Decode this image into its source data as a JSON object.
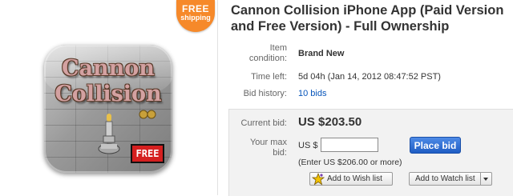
{
  "badge": {
    "line1": "FREE",
    "line2": "shipping"
  },
  "app_icon": {
    "word1": "Cannon",
    "word2": "Collision",
    "tag": "FREE"
  },
  "listing": {
    "title": "Cannon Collision iPhone App (Paid Version and Free Version) - Full Ownership",
    "condition_label": "Item condition:",
    "condition_value": "Brand New",
    "time_left_label": "Time left:",
    "time_left_value": "5d 04h (Jan 14, 2012 08:47:52 PST)",
    "bid_history_label": "Bid history:",
    "bid_history_value": "10 bids"
  },
  "bidding": {
    "current_bid_label": "Current bid:",
    "current_bid_value": "US $203.50",
    "max_bid_label": "Your max bid:",
    "currency_prefix": "US $",
    "max_bid_value": "",
    "place_bid_label": "Place bid",
    "hint": "(Enter US $206.00 or more)",
    "wish_list_label": "Add to Wish list",
    "watch_list_label": "Add to Watch list"
  },
  "colors": {
    "badge": "#f6892a",
    "link": "#0654ba",
    "place_bid": "#1f5dc4",
    "free_tag": "#d51f1f",
    "panel_bg": "#f2f2f2"
  }
}
